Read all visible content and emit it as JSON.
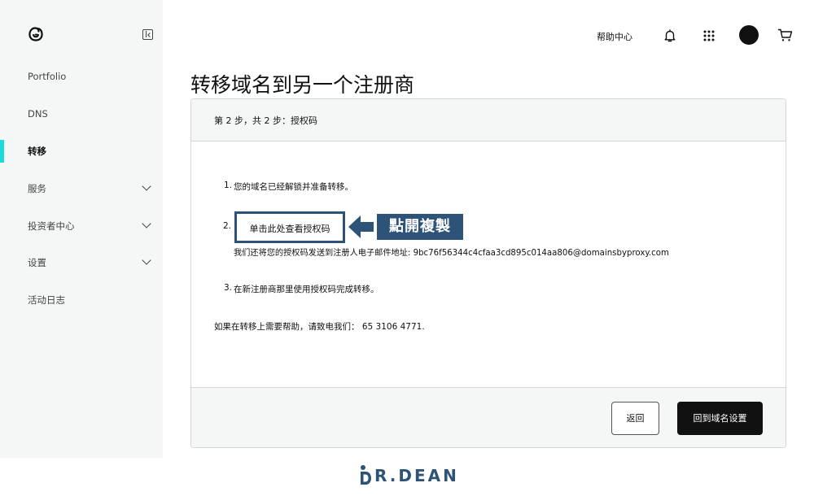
{
  "topbar": {
    "help_label": "帮助中心"
  },
  "sidebar": {
    "items": [
      {
        "label": "Portfolio",
        "expandable": false,
        "active": false
      },
      {
        "label": "DNS",
        "expandable": false,
        "active": false
      },
      {
        "label": "转移",
        "expandable": false,
        "active": true
      },
      {
        "label": "服务",
        "expandable": true,
        "active": false
      },
      {
        "label": "投资者中心",
        "expandable": true,
        "active": false
      },
      {
        "label": "设置",
        "expandable": true,
        "active": false
      },
      {
        "label": "活动日志",
        "expandable": false,
        "active": false
      }
    ]
  },
  "page": {
    "title": "转移域名到另一个注册商"
  },
  "card": {
    "step_text": "第 2 步，共 2 步：授权码",
    "item1": {
      "num": "1.",
      "text": "您的域名已经解锁并准备转移。"
    },
    "item2": {
      "num": "2.",
      "button_label": "单击此处查看授权码",
      "note": "我们还将您的授权码发送到注册人电子邮件地址: 9bc76f56344c4cfaa3cd895c014aa806@domainsbyproxy.com"
    },
    "item3": {
      "num": "3.",
      "text": "在新注册商那里使用授权码完成转移。"
    },
    "help_text": "如果在转移上需要帮助，请致电我们： 65 3106 4771."
  },
  "annotation": {
    "callout_text": "點開複製"
  },
  "footer": {
    "back_label": "返回",
    "primary_label": "回到域名设置"
  },
  "watermark": {
    "text": "R.DEAN"
  },
  "colors": {
    "accent": "#1bdbdb",
    "annotation": "#2e5378",
    "sidebar_bg": "#f5f6f6",
    "primary_button": "#111111"
  }
}
